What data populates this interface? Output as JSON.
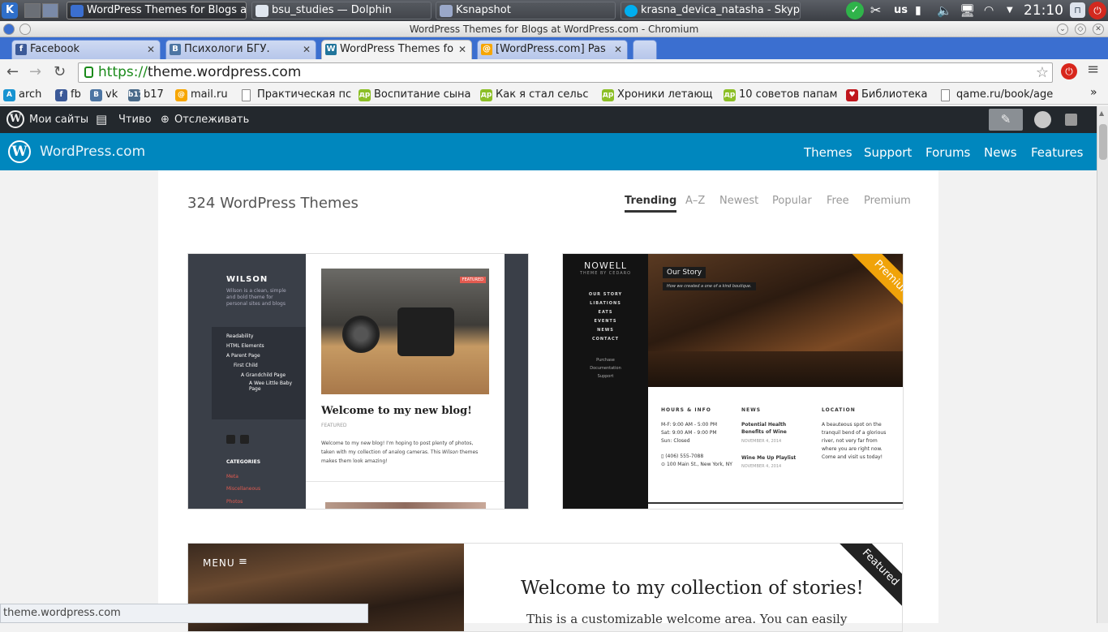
{
  "taskbar": {
    "tasks": [
      "WordPress Themes for Blogs at",
      "bsu_studies — Dolphin",
      "Ksnapshot",
      "krasna_devica_natasha - Skype"
    ],
    "lang": "us",
    "clock": "21:10"
  },
  "window": {
    "title": "WordPress Themes for Blogs at WordPress.com - Chromium"
  },
  "tabs": [
    {
      "title": "Facebook",
      "icon": "f"
    },
    {
      "title": "Психологи БГУ.",
      "icon": "B"
    },
    {
      "title": "WordPress Themes fo",
      "icon": "W"
    },
    {
      "title": "[WordPress.com] Pas",
      "icon": "@"
    }
  ],
  "omnibox": {
    "scheme": "https://",
    "host": "theme.wordpress.com"
  },
  "bookmarks": [
    {
      "label": "arch",
      "icon": "A",
      "color": "#1793d1"
    },
    {
      "label": "fb",
      "icon": "f",
      "color": "#3b5998"
    },
    {
      "label": "vk",
      "icon": "B",
      "color": "#4c75a3"
    },
    {
      "label": "b17",
      "icon": "b17",
      "color": "#4a6b8a"
    },
    {
      "label": "mail.ru",
      "icon": "@",
      "color": "#f7a600"
    },
    {
      "label": "Практическая пс",
      "icon": "",
      "color": "#ffffff"
    },
    {
      "label": "Воспитание сына",
      "icon": "др",
      "color": "#8cbf26"
    },
    {
      "label": "Как я стал сельс",
      "icon": "др",
      "color": "#8cbf26"
    },
    {
      "label": "Хроники летающ",
      "icon": "др",
      "color": "#8cbf26"
    },
    {
      "label": "10 советов папам",
      "icon": "др",
      "color": "#8cbf26"
    },
    {
      "label": "Библиотека",
      "icon": "♥",
      "color": "#c0161d"
    },
    {
      "label": "qame.ru/book/age",
      "icon": "",
      "color": "#ffffff"
    }
  ],
  "bookmarks_more": "»",
  "adminbar": {
    "my_sites": "Мои сайты",
    "reader": "Чтиво",
    "follow": "Отслеживать"
  },
  "wpcom": {
    "brand": "WordPress.com",
    "nav": [
      "Themes",
      "Support",
      "Forums",
      "News",
      "Features"
    ]
  },
  "themes_page": {
    "count_label": "324 WordPress Themes",
    "filters": [
      "Trending",
      "A–Z",
      "Newest",
      "Popular",
      "Free",
      "Premium"
    ],
    "active_filter": "Trending"
  },
  "wilson": {
    "name": "WILSON",
    "tagline": "Wilson is a clean, simple and bold theme for personal sites and blogs",
    "menu": [
      "Readability",
      "HTML Elements",
      "A Parent Page",
      "First Child",
      "A Grandchild Page",
      "A Wee Little Baby Page"
    ],
    "categories_title": "CATEGORIES",
    "categories": [
      "Meta",
      "Miscellaneous",
      "Photos"
    ],
    "featured_tag": "FEATURED",
    "post_title": "Welcome to my new blog!",
    "post_meta": "FEATURED",
    "post_text_a": "Welcome to my new blog! I'm hoping to post plenty of photos, taken with my collection of analog cameras. This ",
    "post_text_em": "Wilson",
    "post_text_b": " themes makes them look amazing!"
  },
  "nowell": {
    "name": "NOWELL",
    "byline": "THEME BY CEDARO",
    "menu": [
      "OUR STORY",
      "LIBATIONS",
      "EATS",
      "EVENTS",
      "NEWS",
      "CONTACT"
    ],
    "links": [
      "Purchase",
      "Documentation",
      "Support"
    ],
    "hero_title": "Our Story",
    "hero_sub": "How we created a one of a kind boutique.",
    "ribbon": "Premium",
    "hours_title": "HOURS & INFO",
    "hours": [
      "M-F: 9:00 AM - 5:00 PM",
      "Sat: 9:00 AM - 9:00 PM",
      "Sun: Closed"
    ],
    "phone": "(406) 555-7088",
    "address": "100 Main St., New York, NY",
    "news_title": "NEWS",
    "news": [
      {
        "title": "Potential Health Benefits of Wine",
        "date": "NOVEMBER 4, 2014"
      },
      {
        "title": "Wine Me Up Playlist",
        "date": "NOVEMBER 4, 2014"
      }
    ],
    "location_title": "LOCATION",
    "location_text": "A beauteous spot on the tranquil bend of a glorious river, not very far from where you are right now. Come and visit us today!"
  },
  "third": {
    "menu": "MENU",
    "headline": "Welcome to my collection of stories!",
    "subline": "This is a customizable welcome area. You can easily",
    "ribbon": "Featured"
  },
  "status_url": "theme.wordpress.com"
}
